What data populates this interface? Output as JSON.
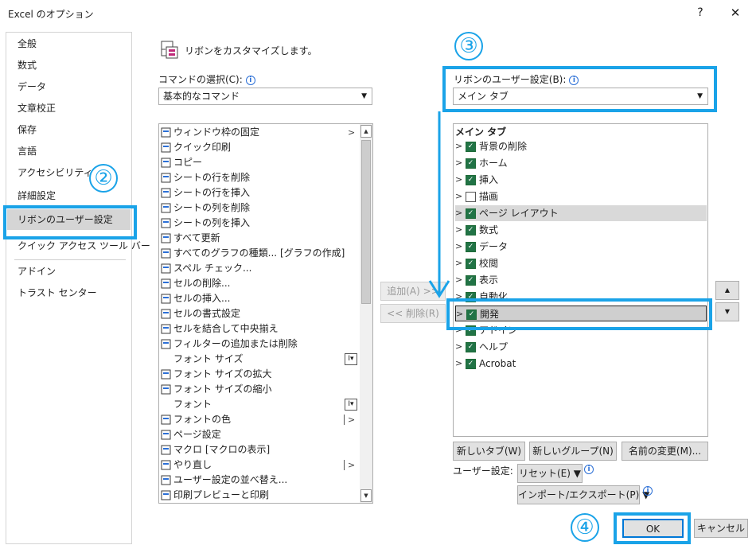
{
  "window": {
    "title": "Excel のオプション",
    "help": "?",
    "close": "✕"
  },
  "nav": {
    "items": [
      {
        "label": "全般"
      },
      {
        "label": "数式"
      },
      {
        "label": "データ"
      },
      {
        "label": "文章校正"
      },
      {
        "label": "保存"
      },
      {
        "label": "言語"
      },
      {
        "label": "アクセシビリティ"
      },
      {
        "label": "詳細設定"
      },
      {
        "label": "リボンのユーザー設定",
        "selected": true
      },
      {
        "label": "クイック アクセス ツール バー"
      },
      {
        "label": "アドイン"
      },
      {
        "label": "トラスト センター"
      }
    ]
  },
  "annotations": {
    "step2": "②",
    "step3": "③",
    "step4": "④",
    "color": "#1aa3e8"
  },
  "heading": {
    "text": "リボンをカスタマイズします。"
  },
  "commands": {
    "label": "コマンドの選択(C):",
    "dropdown_value": "基本的なコマンド",
    "items": [
      {
        "label": "ウィンドウ枠の固定",
        "icon": "freeze-panes-icon",
        "submenu": true
      },
      {
        "label": "クイック印刷",
        "icon": "quick-print-icon"
      },
      {
        "label": "コピー",
        "icon": "copy-icon"
      },
      {
        "label": "シートの行を削除",
        "icon": "delete-row-icon"
      },
      {
        "label": "シートの行を挿入",
        "icon": "insert-row-icon"
      },
      {
        "label": "シートの列を削除",
        "icon": "delete-column-icon"
      },
      {
        "label": "シートの列を挿入",
        "icon": "insert-column-icon"
      },
      {
        "label": "すべて更新",
        "icon": "refresh-all-icon"
      },
      {
        "label": "すべてのグラフの種類... [グラフの作成]",
        "icon": "chart-icon"
      },
      {
        "label": "スペル チェック...",
        "icon": "spell-check-icon"
      },
      {
        "label": "セルの削除...",
        "icon": "delete-cells-icon"
      },
      {
        "label": "セルの挿入...",
        "icon": "insert-cells-icon"
      },
      {
        "label": "セルの書式設定",
        "icon": "format-cells-icon"
      },
      {
        "label": "セルを結合して中央揃え",
        "icon": "merge-center-icon"
      },
      {
        "label": "フィルターの追加または削除",
        "icon": "filter-icon"
      },
      {
        "label": "フォント サイズ",
        "icon": "",
        "control": "box"
      },
      {
        "label": "フォント サイズの拡大",
        "icon": "font-grow-icon"
      },
      {
        "label": "フォント サイズの縮小",
        "icon": "font-shrink-icon"
      },
      {
        "label": "フォント",
        "icon": "",
        "control": "box"
      },
      {
        "label": "フォントの色",
        "icon": "font-color-icon",
        "control": "split"
      },
      {
        "label": "ページ設定",
        "icon": "page-setup-icon"
      },
      {
        "label": "マクロ [マクロの表示]",
        "icon": "macro-icon"
      },
      {
        "label": "やり直し",
        "icon": "redo-icon",
        "control": "split"
      },
      {
        "label": "ユーザー設定の並べ替え...",
        "icon": "sort-icon"
      },
      {
        "label": "印刷プレビューと印刷",
        "icon": "print-preview-icon"
      }
    ]
  },
  "move_buttons": {
    "add": "追加(A) >>",
    "remove": "<< 削除(R)"
  },
  "ribbon": {
    "label": "リボンのユーザー設定(B):",
    "dropdown_value": "メイン タブ",
    "tree_header": "メイン タブ",
    "tabs": [
      {
        "label": "背景の削除",
        "checked": true
      },
      {
        "label": "ホーム",
        "checked": true
      },
      {
        "label": "挿入",
        "checked": true
      },
      {
        "label": "描画",
        "checked": false
      },
      {
        "label": "ページ レイアウト",
        "checked": true,
        "hover": true
      },
      {
        "label": "数式",
        "checked": true
      },
      {
        "label": "データ",
        "checked": true
      },
      {
        "label": "校閲",
        "checked": true
      },
      {
        "label": "表示",
        "checked": true
      },
      {
        "label": "自動化",
        "checked": true
      },
      {
        "label": "開発",
        "checked": true,
        "selected": true
      },
      {
        "label": "アドイン",
        "checked": true
      },
      {
        "label": "ヘルプ",
        "checked": true
      },
      {
        "label": "Acrobat",
        "checked": true
      }
    ],
    "new_tab": "新しいタブ(W)",
    "new_group": "新しいグループ(N)",
    "rename": "名前の変更(M)...",
    "user_settings_label": "ユーザー設定:",
    "reset": "リセット(E) ▼",
    "import_export": "インポート/エクスポート(P) ▼"
  },
  "footer": {
    "ok": "OK",
    "cancel": "キャンセル"
  }
}
